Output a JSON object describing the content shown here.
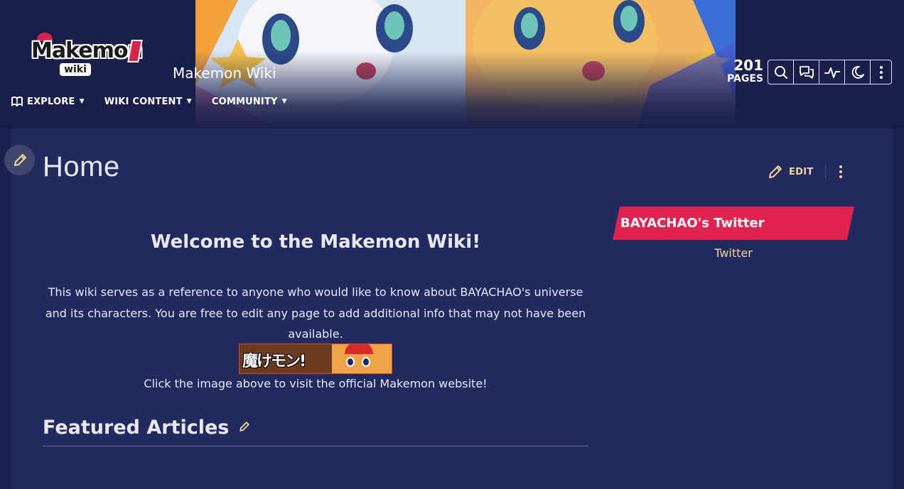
{
  "header": {
    "logo_text": "Makemon",
    "logo_sub": "wiki",
    "site_name": "Makemon Wiki",
    "pages_count": "201",
    "pages_label": "PAGES",
    "nav": [
      {
        "label": "EXPLORE",
        "icon": "book-icon"
      },
      {
        "label": "WIKI CONTENT"
      },
      {
        "label": "COMMUNITY"
      }
    ],
    "tools": [
      "search-icon",
      "discussions-icon",
      "activity-icon",
      "dark-mode-icon",
      "more-icon"
    ]
  },
  "page": {
    "title": "Home",
    "edit_label": "EDIT",
    "welcome_heading": "Welcome to the Makemon Wiki!",
    "intro_text": "This wiki serves as a reference to anyone who would like to know about BAYACHAO's universe and its characters. You are free to edit any page to add additional info that may not have been available.",
    "banner_text": "魔けモン!",
    "click_note": "Click the image above to visit the official Makemon website!",
    "featured_heading": "Featured Articles"
  },
  "sidebar": {
    "twitter_title": "BAYACHAO's Twitter",
    "twitter_link": "Twitter"
  },
  "colors": {
    "background": "#1c2150",
    "content_bg": "#222a5f",
    "accent_red": "#e0234f",
    "link_gold": "#f0d79a"
  }
}
